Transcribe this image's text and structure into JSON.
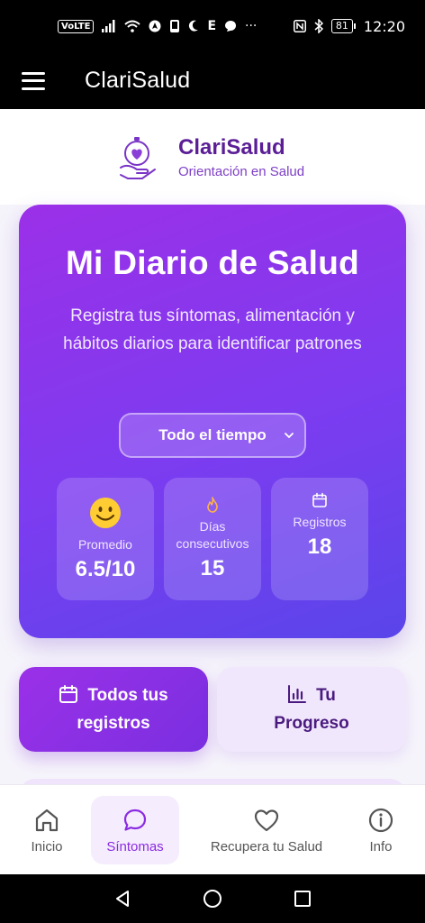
{
  "status_bar": {
    "left_badges": [
      "VoLTE",
      "E"
    ],
    "battery": "81",
    "time": "12:20"
  },
  "app_bar": {
    "title": "ClariSalud"
  },
  "brand": {
    "name": "ClariSalud",
    "subtitle": "Orientación en Salud"
  },
  "hero": {
    "title": "Mi Diario de Salud",
    "subtitle": "Registra tus síntomas, alimentación y hábitos diarios para identificar patrones",
    "period_select": "Todo el tiempo",
    "stats": [
      {
        "icon": "smile-emoji-icon",
        "label": "Promedio",
        "value": "6.5/10"
      },
      {
        "icon": "flame-icon",
        "label": "Días consecutivos",
        "value": "15"
      },
      {
        "icon": "calendar-icon",
        "label": "Registros",
        "value": "18"
      }
    ]
  },
  "actions": {
    "records_label": "Todos tus registros",
    "progress_label": "Tu Progreso"
  },
  "bottom_nav": {
    "items": [
      {
        "icon": "home-icon",
        "label": "Inicio"
      },
      {
        "icon": "chat-icon",
        "label": "Síntomas",
        "active": true
      },
      {
        "icon": "heart-icon",
        "label": "Recupera tu Salud"
      },
      {
        "icon": "info-icon",
        "label": "Info"
      }
    ]
  },
  "colors": {
    "brand_purple": "#5b1e96",
    "hero_gradient_start": "#9b30e8",
    "hero_gradient_end": "#5945ea",
    "active_nav": "#8a2be2"
  }
}
